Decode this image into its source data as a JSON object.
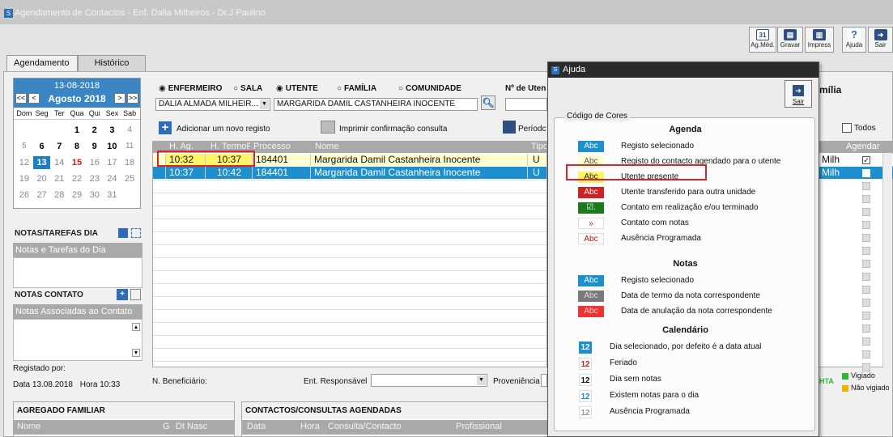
{
  "window": {
    "title": "Agendamento de Contactos - Enf. Dalia Milheiros - Dr.J Paulino"
  },
  "toolbar": {
    "buttons": [
      {
        "label": "Ag.Méd.",
        "icon": "calendar-icon",
        "glyph": "31"
      },
      {
        "label": "Gravar",
        "icon": "save-icon",
        "glyph": "▤"
      },
      {
        "label": "Impress",
        "icon": "printer-icon",
        "glyph": "▥"
      },
      {
        "label": "Ajuda",
        "icon": "help-icon",
        "glyph": "?"
      },
      {
        "label": "Sair",
        "icon": "exit-icon",
        "glyph": "➜"
      }
    ]
  },
  "tabs": [
    {
      "label": "Agendamento"
    },
    {
      "label": "Histórico"
    }
  ],
  "calendar": {
    "date": "13-08-2018",
    "month": "Agosto 2018",
    "nav_prev2": "<<",
    "nav_prev": "<",
    "nav_next": ">",
    "nav_next2": ">>",
    "weekdays": [
      "Dom",
      "Seg",
      "Ter",
      "Qua",
      "Qui",
      "Sex",
      "Sab"
    ],
    "rows": [
      [
        "",
        "",
        "",
        "1",
        "2",
        "3",
        "4"
      ],
      [
        "5",
        "6",
        "7",
        "8",
        "9",
        "10",
        "11"
      ],
      [
        "12",
        "13",
        "14",
        "15",
        "16",
        "17",
        "18"
      ],
      [
        "19",
        "20",
        "21",
        "22",
        "23",
        "24",
        "25"
      ],
      [
        "26",
        "27",
        "28",
        "29",
        "30",
        "31",
        ""
      ]
    ]
  },
  "notas_tarefas": {
    "title": "NOTAS/TAREFAS DIA",
    "text": "Notas e Tarefas do Dia"
  },
  "notas_contato": {
    "title": "NOTAS CONTATO",
    "text": "Notas Associadas ao Contato"
  },
  "registo": {
    "label": "Registado por:",
    "data_label": "Data",
    "data": "13.08.2018",
    "hora_label": "Hora",
    "hora": "10:33"
  },
  "radios": {
    "enfermeiro": "ENFERMEIRO",
    "sala": "SALA",
    "utente": "UTENTE",
    "familia": "FAMÍLIA",
    "comunidade": "COMUNIDADE"
  },
  "no_utente_label": "Nº de Uten",
  "familia_label": "mília",
  "selects": {
    "enfermeiro": "DALIA ALMADA MILHEIR...",
    "utente": "MARGARIDA DAMIL CASTANHEIRA INOCENTE"
  },
  "actions": {
    "add": "Adicionar um novo registo",
    "print": "Imprimir confirmação consulta",
    "periodo": "Períodc"
  },
  "table": {
    "headers": [
      "H. Ag.",
      "H. TermoP",
      "Processo",
      "Nome",
      "Tipo"
    ],
    "rows": [
      {
        "h_ag": "10:32",
        "h_termo": "10:37",
        "processo": "184401",
        "nome": "Margarida Damil Castanheira Inocente",
        "tipo": "U",
        "right": "a Milh"
      },
      {
        "h_ag": "10:37",
        "h_termo": "10:42",
        "processo": "184401",
        "nome": "Margarida Damil Castanheira Inocente",
        "tipo": "U",
        "right": "a Milh"
      }
    ]
  },
  "right_col": {
    "todos": "Todos",
    "agendar": "Agendar"
  },
  "bottom": {
    "beneficiario": "N. Beneficiário:",
    "ent_resp": "Ent. Responsável",
    "proveniencia": "Proveniência",
    "hta": "HTA",
    "vigiado": "Vigiado",
    "nao_vigiado": "Não vigiado",
    "agregado": "AGREGADO FAMILIAR",
    "agregado_cols": [
      "Nome",
      "G",
      "Dt Nasc"
    ],
    "contactos": "CONTACTOS/CONSULTAS AGENDADAS",
    "contactos_cols": [
      "Data",
      "Hora",
      "Consulta/Contacto",
      "Profissional"
    ]
  },
  "help": {
    "title": "Ajuda",
    "exit": "Sair",
    "group_label": "Código de Cores",
    "agenda_title": "Agenda",
    "agenda": [
      {
        "swatch": "Abc",
        "bg": "#1d8fcf",
        "fg": "#ffffff",
        "label": "Registo selecionado"
      },
      {
        "swatch": "Abc",
        "bg": "#ffffcc",
        "fg": "#555555",
        "label": "Registo do contacto agendado para o utente"
      },
      {
        "swatch": "Abc",
        "bg": "#fff566",
        "fg": "#222222",
        "label": "Utente presente"
      },
      {
        "swatch": "Abc",
        "bg": "#cc2222",
        "fg": "#ffffff",
        "label": "Utente transferido para outra unidade"
      },
      {
        "swatch": "☑.",
        "bg": "#1c7a1c",
        "fg": "#ffffff",
        "label": "Contato em realização e/ou terminado"
      },
      {
        "swatch": "»",
        "bg": "#ffffff",
        "fg": "#d01010",
        "label": "Contato com notas"
      },
      {
        "swatch": "Abc",
        "bg": "#ffffff",
        "fg": "#d01010",
        "label": "Ausência Programada"
      }
    ],
    "notas_title": "Notas",
    "notas": [
      {
        "swatch": "Abc",
        "bg": "#1d8fcf",
        "fg": "#ffffff",
        "label": "Registo selecionado"
      },
      {
        "swatch": "Abc",
        "bg": "#7a7a7a",
        "fg": "#dddddd",
        "label": "Data de termo da nota correspondente"
      },
      {
        "swatch": "Abc",
        "bg": "#ee3333",
        "fg": "#ffcccc",
        "label": "Data de anulação da nota correspondente"
      }
    ],
    "cal_title": "Calendário",
    "cal": [
      {
        "num": "12",
        "bg": "#1d8fcf",
        "fg": "#ffffff",
        "label": "Dia selecionado, por defeito é a data atual"
      },
      {
        "num": "12",
        "bg": "#ffffff",
        "fg": "#c82020",
        "label": "Feriado"
      },
      {
        "num": "12",
        "bg": "#ffffff",
        "fg": "#111111",
        "label": "Dia sem notas"
      },
      {
        "num": "12",
        "bg": "#ffffff",
        "fg": "#1d8fcf",
        "label": "Existem notas para o dia"
      },
      {
        "num": "12",
        "bg": "#ffffff",
        "fg": "#999999",
        "label": "Ausência Programada"
      }
    ]
  }
}
